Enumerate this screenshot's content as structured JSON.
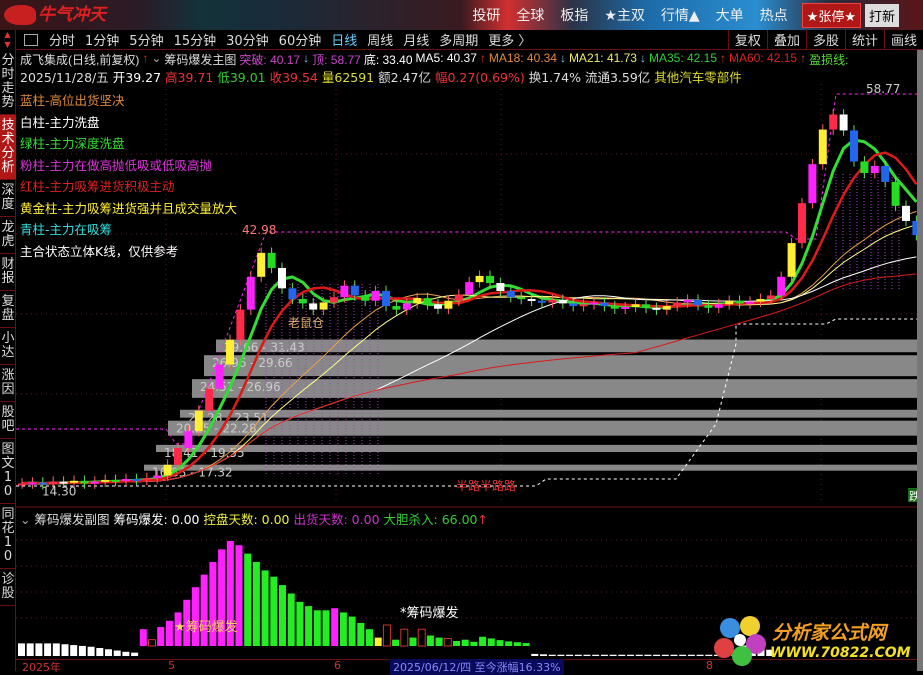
{
  "topbar": {
    "logo": "牛气冲天",
    "nav": [
      "投研",
      "全球",
      "板指",
      "★主双",
      "行情▲",
      "大单",
      "热点"
    ],
    "zhangting": "★张停★",
    "daxin": "打新"
  },
  "toolbar": {
    "periods": [
      "分时",
      "1分钟",
      "5分钟",
      "15分钟",
      "30分钟",
      "60分钟",
      "日线",
      "周线",
      "月线",
      "多周期",
      "更多 〉"
    ],
    "active": "日线",
    "right": [
      "复权",
      "叠加",
      "多股",
      "统计",
      "画线"
    ]
  },
  "sidebar": {
    "tabs": [
      "分时走势",
      "技术分析",
      "深度",
      "龙虎",
      "财报",
      "复盘",
      "小达",
      "涨因",
      "股吧",
      "图文10",
      "同花10",
      "诊股"
    ],
    "active": "技术分析"
  },
  "header": {
    "stock": "成飞集成(日线,前复权)",
    "indicator": "筹码爆发主图",
    "tupo": "突破: 40.17",
    "ding": "顶: 58.77",
    "di": "底: 33.40",
    "ma5": "MA5: 40.37",
    "ma18": "MA18: 40.34",
    "ma21": "MA21: 41.73",
    "ma35": "MA35: 42.15",
    "ma60": "MA60: 42.15",
    "yingsun": "盈损线:"
  },
  "quote": {
    "date": "2025/11/28/五",
    "open": "开39.27",
    "high": "高39.71",
    "low": "低39.01",
    "close": "收39.54",
    "vol": "量62591",
    "amount": "额2.47亿",
    "change": "幅0.27(0.69%)",
    "turnover": "换1.74%",
    "float": "流通3.59亿",
    "sector": "其他汽车零部件"
  },
  "legend": [
    {
      "text": "蓝柱-高位出货坚决",
      "color": "#e08a3a"
    },
    {
      "text": "白柱-主力洗盘",
      "color": "#ffffff"
    },
    {
      "text": "绿柱-主力深度洗盘",
      "color": "#33dd33"
    },
    {
      "text": "粉柱-主力在做高抛低吸或低吸高抛",
      "color": "#dd33dd"
    },
    {
      "text": "红柱-主力吸筹进货积极主动",
      "color": "#dd2222"
    },
    {
      "text": "黄金柱-主力吸筹进货强并且成交量放大",
      "color": "#ffee33"
    },
    {
      "text": "青柱-主力在吸筹",
      "color": "#33dddd"
    },
    {
      "text": "主合状态立体K线，仅供参考",
      "color": "#ffffff"
    }
  ],
  "colors": {
    "up": "#ff2a2a",
    "down": "#22dd22",
    "ma_red": "#dd1a1a",
    "ma_yellow": "#ffff88",
    "ma_orange": "#e8a050",
    "band": "#888888",
    "magenta": "#ff22ff"
  },
  "chart_data": {
    "type": "candlestick",
    "price_labels": {
      "high": "58.77",
      "mid_high": "42.98",
      "low": "14.30"
    },
    "annotations": [
      "老鼠仓",
      "半路半路路",
      "跌"
    ],
    "closes": [
      15.2,
      15.3,
      15.1,
      15.4,
      15.3,
      15.5,
      15.2,
      15.4,
      15.6,
      15.5,
      15.7,
      15.6,
      15.8,
      16.1,
      17.3,
      19.2,
      21.1,
      23.4,
      25.9,
      28.6,
      31.4,
      34.8,
      38.5,
      41.2,
      39.5,
      37.2,
      36.0,
      35.5,
      34.8,
      35.6,
      36.2,
      37.5,
      36.4,
      35.8,
      36.9,
      35.2,
      34.8,
      35.5,
      36.1,
      35.4,
      34.9,
      35.8,
      36.5,
      37.9,
      38.6,
      37.8,
      36.9,
      36.2,
      36.0,
      35.8,
      35.6,
      35.9,
      35.5,
      35.2,
      35.4,
      35.6,
      35.2,
      34.9,
      35.1,
      35.4,
      35.0,
      34.8,
      35.2,
      35.6,
      35.9,
      35.3,
      35.0,
      35.4,
      35.8,
      35.5,
      35.7,
      36.0,
      36.4,
      38.5,
      42.3,
      46.8,
      51.2,
      55.1,
      56.8,
      55.0,
      51.5,
      50.2,
      51.0,
      49.2,
      46.5,
      44.8,
      43.2
    ],
    "chip_bands": [
      {
        "label": "29.66 - 31.43",
        "lo": 29.66,
        "hi": 31.43
      },
      {
        "label": "26.96 - 29.66",
        "lo": 26.96,
        "hi": 29.66
      },
      {
        "label": "24.51 - 26.96",
        "lo": 24.51,
        "hi": 26.96
      },
      {
        "label": "22.28 - 23.51",
        "lo": 22.28,
        "hi": 23.51
      },
      {
        "label": "20.25 - 22.28",
        "lo": 20.25,
        "hi": 22.28
      },
      {
        "label": "18.41 - 19.55",
        "lo": 18.41,
        "hi": 19.55
      },
      {
        "label": "16.83 - 17.32",
        "lo": 16.83,
        "hi": 17.32
      }
    ],
    "sub": {
      "title": "筹码爆发副图",
      "stats": {
        "cmbf": "筹码爆发: 0.00",
        "kpts": "控盘天数: 0.00",
        "chts": "出货天数: 0.00",
        "dsr": "大胆杀入: 66.00"
      },
      "signal_label": "★筹码爆发",
      "signal_label2": "*筹码爆发",
      "values": [
        3,
        3,
        3,
        3,
        3,
        2.8,
        2.6,
        2.4,
        2.2,
        1.9,
        1.6,
        1.3,
        1.0,
        0.8,
        4,
        1.5,
        4.5,
        6,
        8,
        11,
        14,
        17,
        20,
        23,
        25,
        24,
        22,
        20,
        18,
        16.5,
        14.5,
        12.5,
        10.5,
        9.5,
        8.5,
        8.5,
        9,
        8,
        7,
        5.5,
        4,
        2,
        5,
        1.5,
        4,
        2,
        4,
        2.5,
        2,
        1.8,
        1.2,
        1.5,
        1.0,
        2.2,
        1.8,
        1.4,
        1.1,
        0.9,
        0.7,
        0.5,
        0.4,
        0.3,
        0.3,
        0.3,
        0.3,
        0.3,
        0.3,
        0.3,
        0.3,
        0.3,
        0.3,
        0.3,
        0.3,
        0.3,
        0.3,
        0.3,
        0.3,
        0.3,
        0.3,
        0.3,
        0.3,
        0.3,
        0.3,
        2.5,
        2.4,
        2.3,
        1.5
      ],
      "kinds": "wwwwwwwwwwwwwwmoMMMMMMMMMMGGGGGGGGGGMGGGGyoGoGoGGoGGGGGGGGGwwwwwwwwwwwwwwwwwwwwwwwwwwwwwwwwwwMoGGG"
    }
  },
  "xaxis": {
    "labels": [
      "2025年",
      "5",
      "6",
      "2025/06/12/四  至今涨幅16.33%",
      "8"
    ]
  },
  "watermark": {
    "name": "分析家公式网",
    "url": "WWW.70822.COM"
  }
}
